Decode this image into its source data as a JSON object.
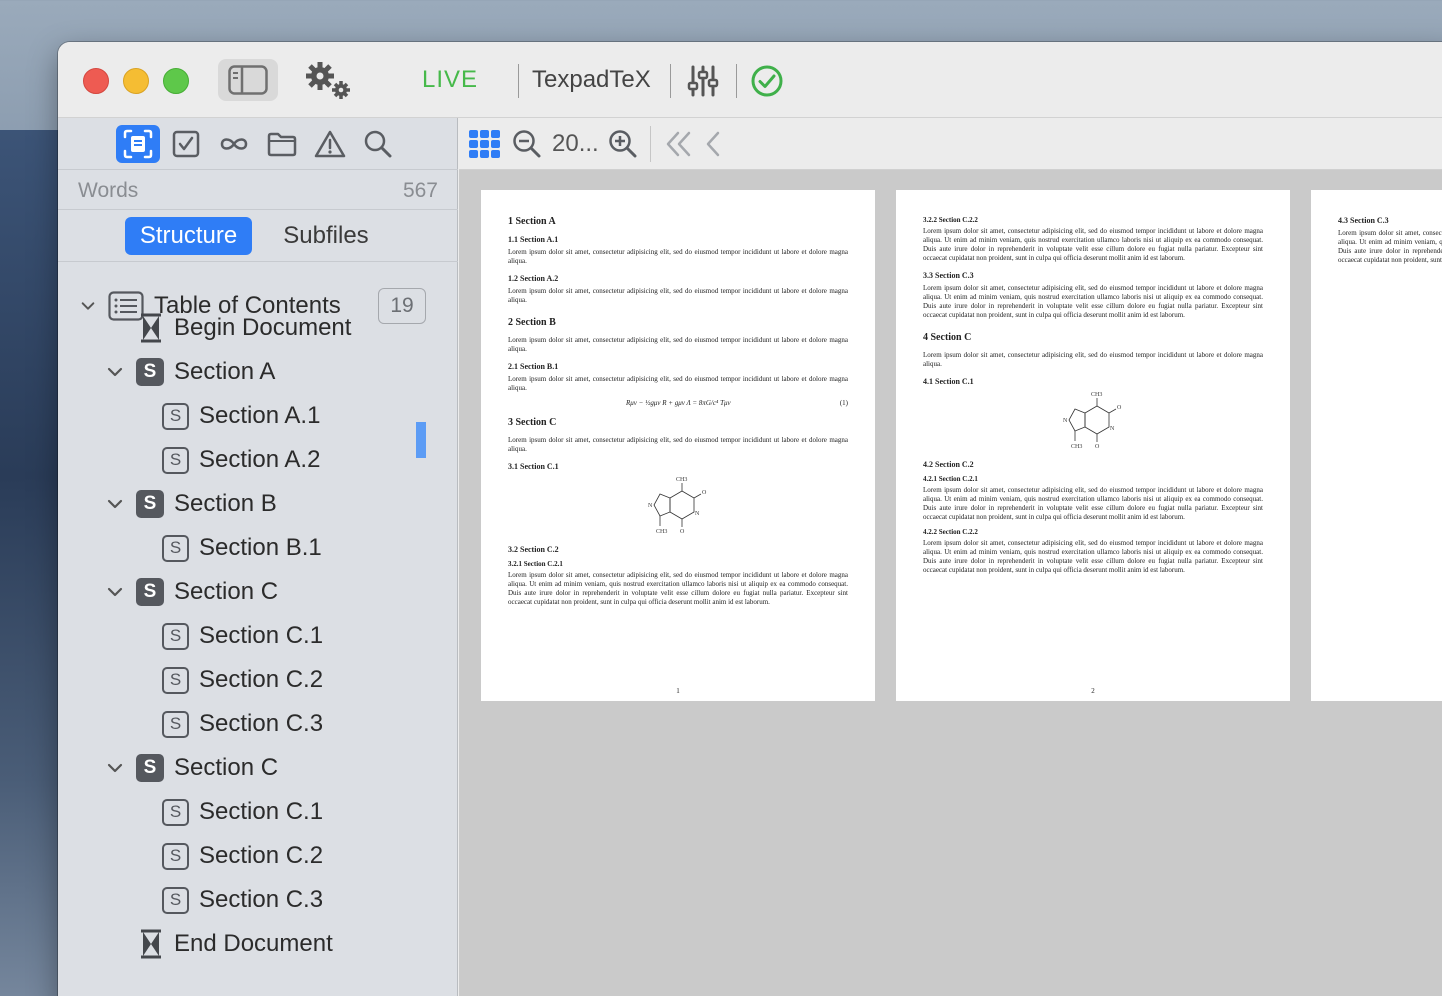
{
  "toolbar": {
    "mode_label": "LIVE",
    "engine_label": "TexpadTeX"
  },
  "sidebar": {
    "tools": [
      {
        "icon": "outline-icon",
        "active": true
      },
      {
        "icon": "checkbox-icon",
        "active": false
      },
      {
        "icon": "infinity-icon",
        "active": false
      },
      {
        "icon": "folder-icon",
        "active": false
      },
      {
        "icon": "warning-icon",
        "active": false
      },
      {
        "icon": "search-icon",
        "active": false
      }
    ],
    "words_label": "Words",
    "words_count": "567",
    "segments": {
      "structure": "Structure",
      "subfiles": "Subfiles"
    },
    "toc_label": "Table of Contents",
    "toc_count": "19",
    "items": [
      {
        "label": "Begin Document"
      },
      {
        "label": "Section A"
      },
      {
        "label": "Section A.1"
      },
      {
        "label": "Section A.2"
      },
      {
        "label": "Section B"
      },
      {
        "label": "Section B.1"
      },
      {
        "label": "Section C"
      },
      {
        "label": "Section C.1"
      },
      {
        "label": "Section C.2"
      },
      {
        "label": "Section C.3"
      },
      {
        "label": "Section C"
      },
      {
        "label": "Section C.1"
      },
      {
        "label": "Section C.2"
      },
      {
        "label": "Section C.3"
      },
      {
        "label": "End Document"
      }
    ]
  },
  "viewer": {
    "zoom": "20..."
  },
  "pages": {
    "lorem_short": "Lorem ipsum dolor sit amet, consectetur adipisicing elit, sed do eiusmod tempor incididunt ut labore et dolore magna aliqua.",
    "lorem_long": "Lorem ipsum dolor sit amet, consectetur adipisicing elit, sed do eiusmod tempor incididunt ut labore et dolore magna aliqua. Ut enim ad minim veniam, quis nostrud exercitation ullamco laboris nisi ut aliquip ex ea commodo consequat. Duis aute irure dolor in reprehenderit in voluptate velit esse cillum dolore eu fugiat nulla pariatur. Excepteur sint occaecat cupidatat non proident, sunt in culpa qui officia deserunt mollit anim id est laborum.",
    "p1": {
      "h_a": "1 Section A",
      "h_a1": "1.1 Section A.1",
      "h_a2": "1.2 Section A.2",
      "h_b": "2 Section B",
      "h_b1": "2.1 Section B.1",
      "equation": "Rμν − ½gμν R + gμν Λ = 8πG/c⁴ Tμν",
      "eq_num": "(1)",
      "h_c": "3 Section C",
      "h_c1": "3.1 Section C.1",
      "h_c2": "3.2 Section C.2",
      "h_c21": "3.2.1 Section C.2.1",
      "page_num": "1"
    },
    "p2": {
      "h_c22": "3.2.2 Section C.2.2",
      "h_c3": "3.3 Section C.3",
      "h_4": "4 Section C",
      "h_41": "4.1 Section C.1",
      "h_42": "4.2 Section C.2",
      "h_421": "4.2.1 Section C.2.1",
      "h_422": "4.2.2 Section C.2.2",
      "page_num": "2"
    },
    "p3": {
      "h_43": "4.3 Section C.3"
    },
    "molecule_labels": {
      "ch3": "CH3",
      "n": "N",
      "o": "O"
    }
  }
}
